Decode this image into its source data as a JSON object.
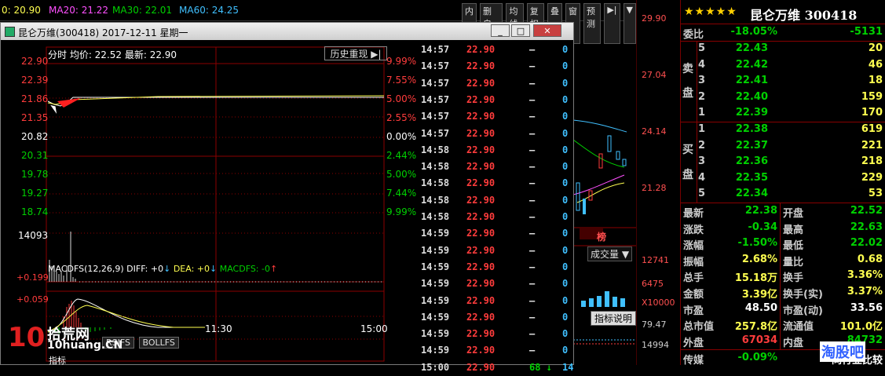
{
  "topbar": {
    "ma_first": "0: 20.90",
    "ma20": "MA20: 21.22",
    "ma30": "MA30: 22.01",
    "ma60": "MA60: 24.25",
    "buttons": [
      "内",
      "删自选",
      "均线",
      "复权",
      "叠",
      "窗",
      "预测",
      "▶|",
      "▼"
    ]
  },
  "right_axis": {
    "prices": [
      "29.90",
      "27.04",
      "24.14",
      "21.28"
    ],
    "volume_label": "成交量",
    "volume_ticks": [
      "12741",
      "6475",
      "X10000"
    ],
    "indicator_label": "指标说明",
    "indicator_ticks": [
      "79.47",
      "14994"
    ],
    "badge": "榜"
  },
  "window": {
    "title": "昆仑万维(300418) 2017-12-11 星期一",
    "btn_min": "_",
    "btn_max": "□",
    "btn_close": "✕",
    "header": "分时 均价: 22.52 最新: 22.90",
    "replay_button": "历史重现",
    "price_labels": [
      "22.90",
      "22.39",
      "21.86",
      "21.35",
      "20.82",
      "20.31",
      "19.78",
      "19.27",
      "18.74"
    ],
    "pct_labels": [
      "9.99%",
      "7.55%",
      "5.00%",
      "2.55%",
      "0.00%",
      "2.44%",
      "5.00%",
      "7.44%",
      "9.99%"
    ],
    "volume_label": "14093",
    "macd_header": "MACDFS(12,26,9)",
    "diff_label": "DIFF: +0",
    "dea_label": "DEA: +0",
    "macdfs_label": "MACDFS: -0",
    "macd_ticks": [
      "+0.199",
      "+0.059"
    ],
    "time_ticks": [
      "11:30",
      "15:00"
    ],
    "bottom_tabs": [
      "RSIFS",
      "BOLLFS"
    ],
    "bottom_left": "指标"
  },
  "ticks": [
    {
      "t": "14:57",
      "p": "22.90",
      "v1": "—",
      "v2": "0"
    },
    {
      "t": "14:57",
      "p": "22.90",
      "v1": "—",
      "v2": "0"
    },
    {
      "t": "14:57",
      "p": "22.90",
      "v1": "—",
      "v2": "0"
    },
    {
      "t": "14:57",
      "p": "22.90",
      "v1": "—",
      "v2": "0"
    },
    {
      "t": "14:57",
      "p": "22.90",
      "v1": "—",
      "v2": "0"
    },
    {
      "t": "14:57",
      "p": "22.90",
      "v1": "—",
      "v2": "0"
    },
    {
      "t": "14:58",
      "p": "22.90",
      "v1": "—",
      "v2": "0"
    },
    {
      "t": "14:58",
      "p": "22.90",
      "v1": "—",
      "v2": "0"
    },
    {
      "t": "14:58",
      "p": "22.90",
      "v1": "—",
      "v2": "0"
    },
    {
      "t": "14:58",
      "p": "22.90",
      "v1": "—",
      "v2": "0"
    },
    {
      "t": "14:58",
      "p": "22.90",
      "v1": "—",
      "v2": "0"
    },
    {
      "t": "14:59",
      "p": "22.90",
      "v1": "—",
      "v2": "0"
    },
    {
      "t": "14:59",
      "p": "22.90",
      "v1": "—",
      "v2": "0"
    },
    {
      "t": "14:59",
      "p": "22.90",
      "v1": "—",
      "v2": "0"
    },
    {
      "t": "14:59",
      "p": "22.90",
      "v1": "—",
      "v2": "0"
    },
    {
      "t": "14:59",
      "p": "22.90",
      "v1": "—",
      "v2": "0"
    },
    {
      "t": "14:59",
      "p": "22.90",
      "v1": "—",
      "v2": "0"
    },
    {
      "t": "14:59",
      "p": "22.90",
      "v1": "—",
      "v2": "0"
    },
    {
      "t": "14:59",
      "p": "22.90",
      "v1": "—",
      "v2": "0"
    },
    {
      "t": "15:00",
      "p": "22.90",
      "v1": "68 ↓",
      "v2": "14"
    }
  ],
  "panel": {
    "stars": "★★★★★",
    "name": "昆仑万维 300418",
    "webi_label": "委比",
    "webi_pct": "-18.05%",
    "webi_val": "-5131",
    "sell_label": [
      "卖",
      "盘"
    ],
    "buy_label": [
      "买",
      "盘"
    ],
    "sell": [
      {
        "lv": "5",
        "p": "22.43",
        "q": "20"
      },
      {
        "lv": "4",
        "p": "22.42",
        "q": "46"
      },
      {
        "lv": "3",
        "p": "22.41",
        "q": "18"
      },
      {
        "lv": "2",
        "p": "22.40",
        "q": "159"
      },
      {
        "lv": "1",
        "p": "22.39",
        "q": "170"
      }
    ],
    "buy": [
      {
        "lv": "1",
        "p": "22.38",
        "q": "619"
      },
      {
        "lv": "2",
        "p": "22.37",
        "q": "221"
      },
      {
        "lv": "3",
        "p": "22.36",
        "q": "218"
      },
      {
        "lv": "4",
        "p": "22.35",
        "q": "229"
      },
      {
        "lv": "5",
        "p": "22.34",
        "q": "53"
      }
    ],
    "stats": [
      {
        "l1": "最新",
        "v1": "22.38",
        "c1": "green",
        "l2": "开盘",
        "v2": "22.52",
        "c2": "green"
      },
      {
        "l1": "涨跌",
        "v1": "-0.34",
        "c1": "green",
        "l2": "最高",
        "v2": "22.63",
        "c2": "green"
      },
      {
        "l1": "涨幅",
        "v1": "-1.50%",
        "c1": "green",
        "l2": "最低",
        "v2": "22.02",
        "c2": "green"
      },
      {
        "l1": "振幅",
        "v1": "2.68%",
        "c1": "yellow",
        "l2": "量比",
        "v2": "0.68",
        "c2": "yellow"
      },
      {
        "l1": "总手",
        "v1": "15.18万",
        "c1": "yellow",
        "l2": "换手",
        "v2": "3.36%",
        "c2": "yellow"
      },
      {
        "l1": "金额",
        "v1": "3.39亿",
        "c1": "yellow",
        "l2": "换手(实)",
        "v2": "3.37%",
        "c2": "yellow"
      },
      {
        "l1": "市盈",
        "v1": "48.50",
        "c1": "white",
        "l2": "市盈(动)",
        "v2": "33.56",
        "c2": "white"
      },
      {
        "l1": "总市值",
        "v1": "257.8亿",
        "c1": "yellow",
        "l2": "流通值",
        "v2": "101.0亿",
        "c2": "yellow"
      },
      {
        "l1": "外盘",
        "v1": "67034",
        "c1": "red",
        "l2": "内盘",
        "v2": "84732",
        "c2": "green"
      }
    ],
    "bottom_l": "传媒",
    "bottom_v": "-0.09%",
    "bottom_r": "同行业比较"
  },
  "watermark": {
    "left_num": "10",
    "left_cn": "拾荒网",
    "left_url": "10huang.CN",
    "right": "淘股吧"
  },
  "colors": {
    "up": "#ff3c3c",
    "down": "#00d000",
    "axis": "#8b0000",
    "avg": "#ffff50"
  }
}
